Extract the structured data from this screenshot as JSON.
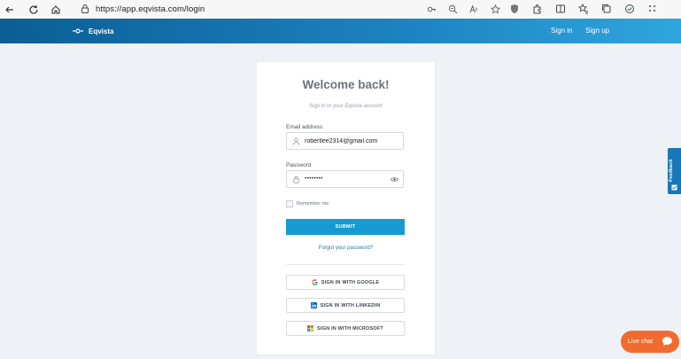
{
  "browser": {
    "url": "https://app.eqvista.com/login"
  },
  "header": {
    "brand": "Eqvista",
    "signin_label": "Sign in",
    "signup_label": "Sign up",
    "color": "#1d83c2"
  },
  "card": {
    "title": "Welcome back!",
    "subtitle": "Sign in to your Eqvista account",
    "email_label": "Email address",
    "email_value": "robertlee2314@gmail.com",
    "password_label": "Password",
    "password_value": "••••••••",
    "remember_label": "Remember me",
    "submit_label": "SUBMIT",
    "forgot_label": "Forgot your password?",
    "google_label": "SIGN IN WITH GOOGLE",
    "linkedin_label": "SIGN IN WITH LINKEDIN",
    "microsoft_label": "SIGN IN WITH MICROSOFT",
    "accent": "#179ad1"
  },
  "feedback": {
    "label": "Feedback"
  },
  "livechat": {
    "label": "Live chat",
    "color": "#f26b2e"
  },
  "icons": [
    "back-arrow-icon",
    "refresh-icon",
    "home-icon",
    "lock-icon",
    "key-icon",
    "zoom-icon",
    "read-aloud-icon",
    "favorite-icon",
    "user-icon",
    "eye-icon",
    "google-icon",
    "linkedin-icon",
    "microsoft-icon",
    "chat-icon"
  ]
}
